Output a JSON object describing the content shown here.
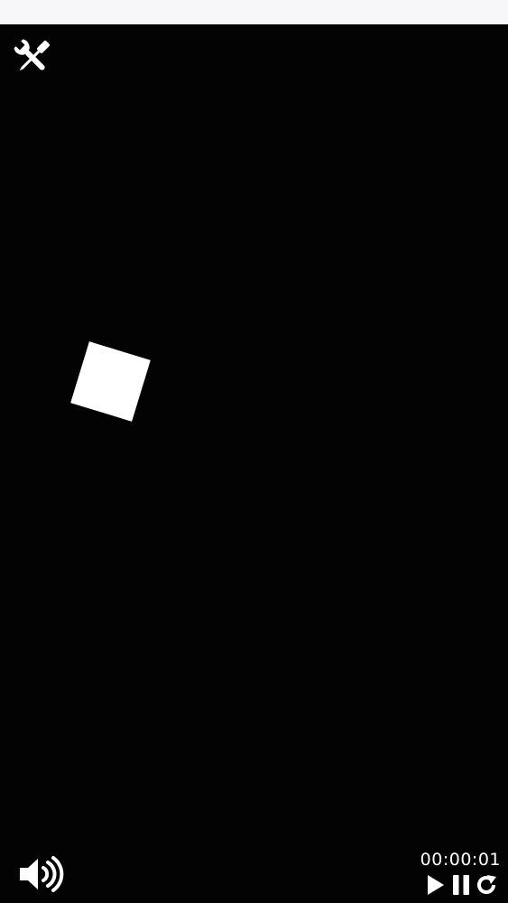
{
  "app": {
    "timer": "00:00:01"
  },
  "colors": {
    "background": "#030303",
    "top_bar": "#f7f7f9",
    "foreground": "#ffffff"
  },
  "icons": {
    "tools": "wrench-screwdriver-icon",
    "volume": "speaker-volume-icon",
    "play": "play-icon",
    "pause": "pause-icon",
    "restart": "restart-icon"
  }
}
